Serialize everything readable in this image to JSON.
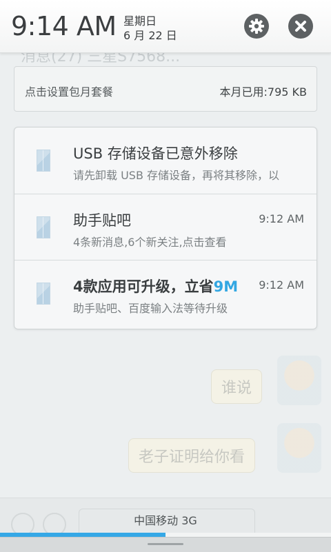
{
  "header": {
    "time": "9:14 AM",
    "weekday": "星期日",
    "date": "6 月 22 日",
    "settings_icon": "gear-icon",
    "clear_icon": "close-icon"
  },
  "data_usage": {
    "hint": "点击设置包月套餐",
    "amount": "本月已用:795 KB"
  },
  "notifications": [
    {
      "title": "USB 存储设备已意外移除",
      "subtitle": "请先卸载 USB 存储设备，再将其移除，以",
      "time": "",
      "icon": "app-icon"
    },
    {
      "title": "助手贴吧",
      "subtitle": "4条新消息,6个新关注,点击查看",
      "time": "9:12 AM",
      "icon": "app-icon"
    },
    {
      "title_main": "4款应用可升级，立省",
      "title_accent": "9M",
      "subtitle": "助手贴吧、百度输入法等待升级",
      "time": "9:12 AM",
      "icon": "app-icon"
    }
  ],
  "background": {
    "chat_title": "消息(27) 三星S7568...",
    "bubble1": "谁说",
    "bubble2": "老子证明给你看"
  },
  "bottom": {
    "carrier": "中国移动 3G",
    "progress": 0.5
  },
  "colors": {
    "accent": "#33a7e2",
    "progress": "#35a8e6"
  }
}
